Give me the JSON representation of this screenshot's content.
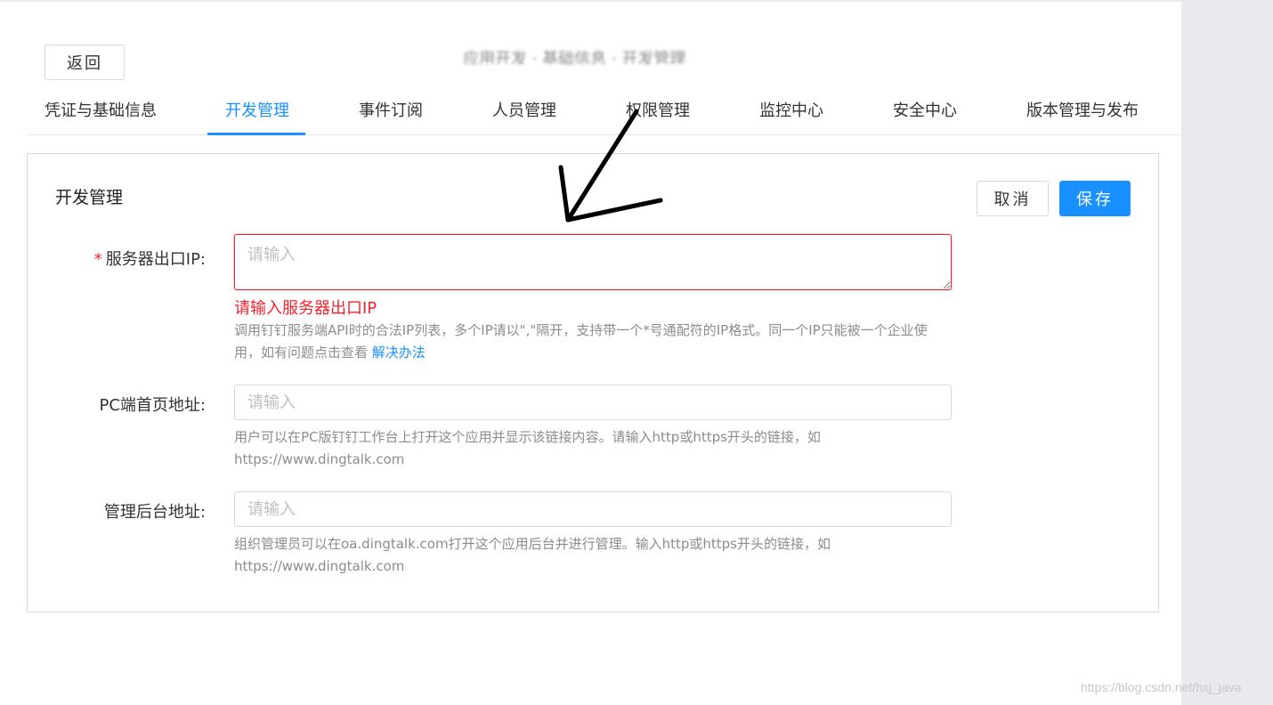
{
  "header": {
    "back_label": "返回",
    "title": "应用开发 · 基础信息 · 开发管理"
  },
  "tabs": [
    {
      "label": "凭证与基础信息",
      "active": false
    },
    {
      "label": "开发管理",
      "active": true
    },
    {
      "label": "事件订阅",
      "active": false
    },
    {
      "label": "人员管理",
      "active": false
    },
    {
      "label": "权限管理",
      "active": false
    },
    {
      "label": "监控中心",
      "active": false
    },
    {
      "label": "安全中心",
      "active": false
    },
    {
      "label": "版本管理与发布",
      "active": false
    }
  ],
  "panel": {
    "title": "开发管理",
    "cancel_label": "取消",
    "save_label": "保存"
  },
  "form": {
    "server_ip": {
      "required_mark": "*",
      "label": "服务器出口IP:",
      "placeholder": "请输入",
      "value": "",
      "error": "请输入服务器出口IP",
      "help": "调用钉钉服务端API时的合法IP列表，多个IP请以\",\"隔开，支持带一个*号通配符的IP格式。同一个IP只能被一个企业使用，如有问题点击查看",
      "help_link": "解决办法"
    },
    "pc_home": {
      "label": "PC端首页地址:",
      "placeholder": "请输入",
      "value": "",
      "help": "用户可以在PC版钉钉工作台上打开这个应用并显示该链接内容。请输入http或https开头的链接，如https://www.dingtalk.com"
    },
    "admin_url": {
      "label": "管理后台地址:",
      "placeholder": "请输入",
      "value": "",
      "help": "组织管理员可以在oa.dingtalk.com打开这个应用后台并进行管理。输入http或https开头的链接，如https://www.dingtalk.com"
    }
  },
  "watermark": "https://blog.csdn.net/hxj_java",
  "colors": {
    "primary": "#1890ff",
    "error": "#f5222d",
    "help_text": "#8c8c8c",
    "border": "#d9d9d9"
  }
}
